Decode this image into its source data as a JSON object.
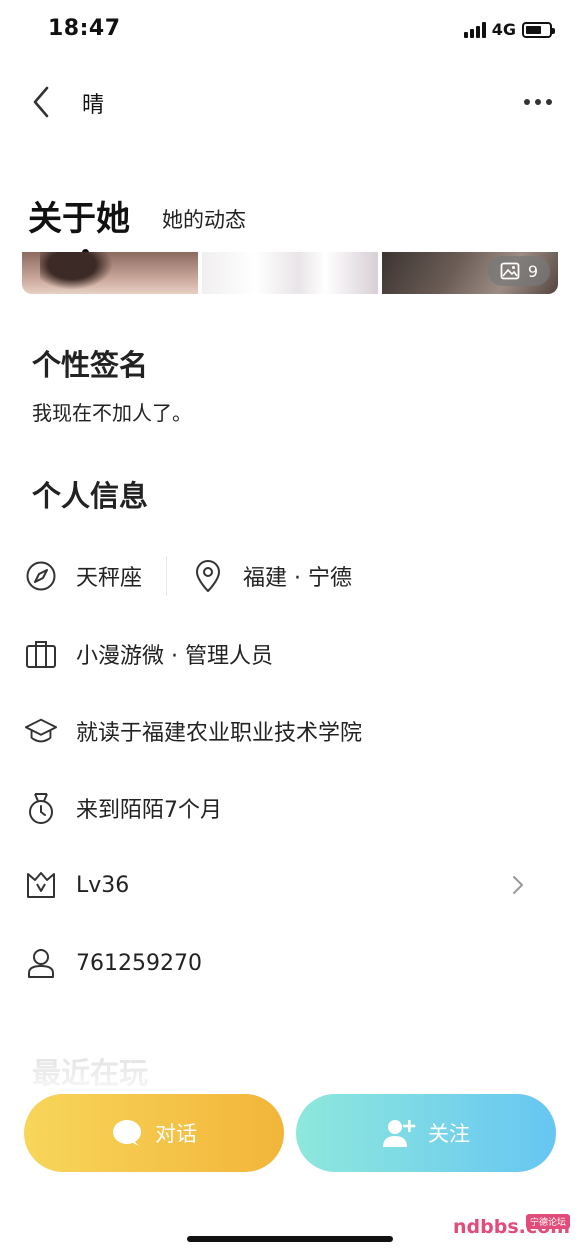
{
  "status_bar": {
    "time": "18:47",
    "network": "4G",
    "battery_level": 0.7
  },
  "nav": {
    "title": "晴",
    "back_icon": "chevron-left-icon",
    "more_icon": "more-dots-icon"
  },
  "tabs": {
    "active": "关于她",
    "other": "她的动态"
  },
  "photos": {
    "count": "9",
    "count_icon": "image-icon"
  },
  "signature": {
    "title": "个性签名",
    "text": "我现在不加人了。"
  },
  "personal_info": {
    "title": "个人信息",
    "constellation": "天秤座",
    "location": "福建 · 宁德",
    "job": "小漫游微 · 管理人员",
    "school": "就读于福建农业职业技术学院",
    "joined": "来到陌陌7个月",
    "level": "Lv36",
    "user_id": "761259270"
  },
  "recent": {
    "title": "最近在玩"
  },
  "actions": {
    "chat_label": "对话",
    "follow_label": "关注"
  },
  "watermark": {
    "brand": "ndbbs.com",
    "badge": "宁德论坛"
  },
  "colors": {
    "chat_start": "#f7d65a",
    "chat_end": "#f2b53a",
    "follow_start": "#8ee8dc",
    "follow_end": "#67c6f2"
  }
}
